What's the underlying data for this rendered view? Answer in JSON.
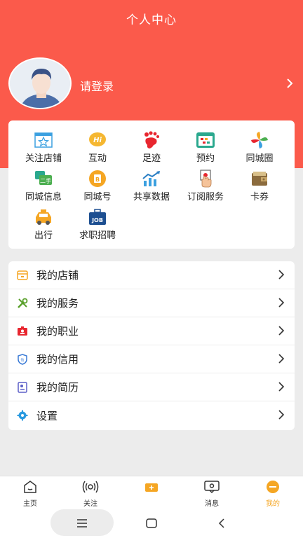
{
  "header": {
    "title": "个人中心",
    "login_label": "请登录",
    "bg_color": "#fb5a4b"
  },
  "grid": [
    {
      "label": "关注店铺",
      "icon": "store-star-icon"
    },
    {
      "label": "互动",
      "icon": "hi-bubble-icon"
    },
    {
      "label": "足迹",
      "icon": "footprint-icon"
    },
    {
      "label": "预约",
      "icon": "calendar-icon"
    },
    {
      "label": "同城圈",
      "icon": "pinwheel-icon"
    },
    {
      "label": "同城信息",
      "icon": "secondhand-icon"
    },
    {
      "label": "同城号",
      "icon": "city-id-icon"
    },
    {
      "label": "共享数据",
      "icon": "trend-chart-icon"
    },
    {
      "label": "订阅服务",
      "icon": "subscribe-hand-icon"
    },
    {
      "label": "卡券",
      "icon": "wallet-icon"
    },
    {
      "label": "出行",
      "icon": "taxi-icon"
    },
    {
      "label": "求职招聘",
      "icon": "job-icon",
      "icon_text": "JOB"
    }
  ],
  "menu": [
    {
      "label": "我的店铺",
      "icon": "shop-icon"
    },
    {
      "label": "我的服务",
      "icon": "tools-icon"
    },
    {
      "label": "我的职业",
      "icon": "badge-icon"
    },
    {
      "label": "我的信用",
      "icon": "credit-shield-icon"
    },
    {
      "label": "我的简历",
      "icon": "resume-icon"
    },
    {
      "label": "设置",
      "icon": "gear-icon"
    }
  ],
  "tabs": [
    {
      "label": "主页",
      "icon": "home-icon"
    },
    {
      "label": "关注",
      "icon": "broadcast-icon"
    },
    {
      "label": "",
      "icon": "plus-icon"
    },
    {
      "label": "消息",
      "icon": "message-icon"
    },
    {
      "label": "我的",
      "icon": "profile-icon",
      "active": true
    }
  ],
  "colors": {
    "accent": "#f5a623"
  }
}
